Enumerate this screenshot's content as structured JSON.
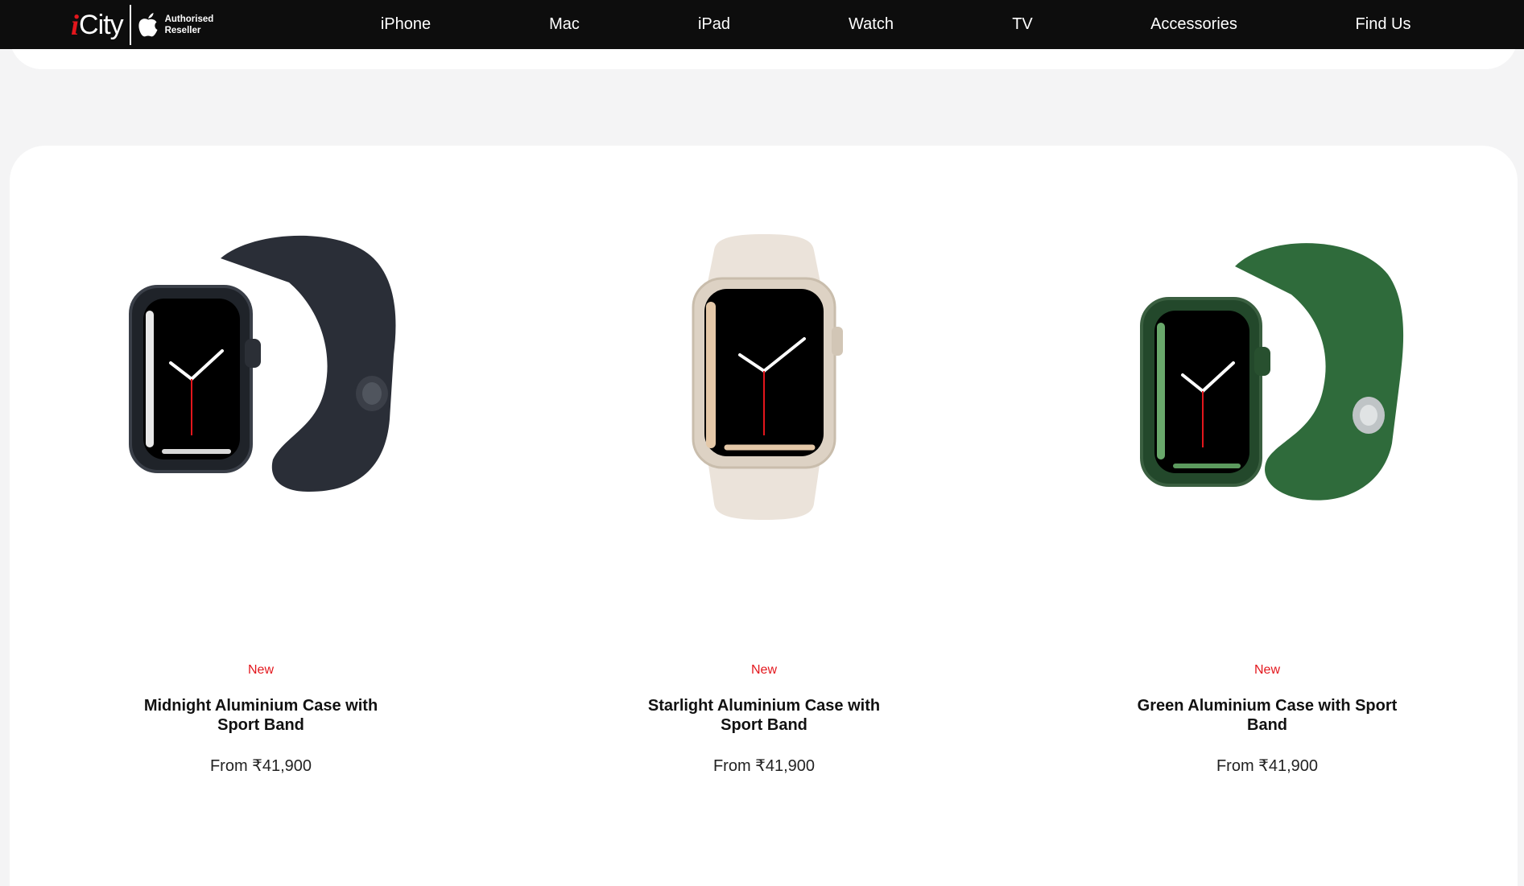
{
  "header": {
    "logo": {
      "i": "i",
      "city": "City",
      "reseller_line1": "Authorised",
      "reseller_line2": "Reseller"
    },
    "nav": [
      {
        "label": "iPhone"
      },
      {
        "label": "Mac"
      },
      {
        "label": "iPad"
      },
      {
        "label": "Watch"
      },
      {
        "label": "TV"
      },
      {
        "label": "Accessories"
      },
      {
        "label": "Find Us"
      }
    ]
  },
  "products": [
    {
      "badge": "New",
      "title": "Midnight Aluminium Case with Sport Band",
      "price": "From ₹41,900",
      "band_color": "#2a2e37",
      "case_color": "#1f2329",
      "image_icon": "midnight-watch"
    },
    {
      "badge": "New",
      "title": "Starlight Aluminium Case with Sport Band",
      "price": "From ₹41,900",
      "band_color": "#ebe3da",
      "case_color": "#ddd2c4",
      "image_icon": "starlight-watch"
    },
    {
      "badge": "New",
      "title": "Green Aluminium Case with Sport Band",
      "price": "From ₹41,900",
      "band_color": "#2f6b3b",
      "case_color": "#23482b",
      "image_icon": "green-watch"
    }
  ],
  "colors": {
    "accent_red": "#e3161c",
    "topbar": "#0d0d0d",
    "page_bg": "#f4f4f5"
  }
}
